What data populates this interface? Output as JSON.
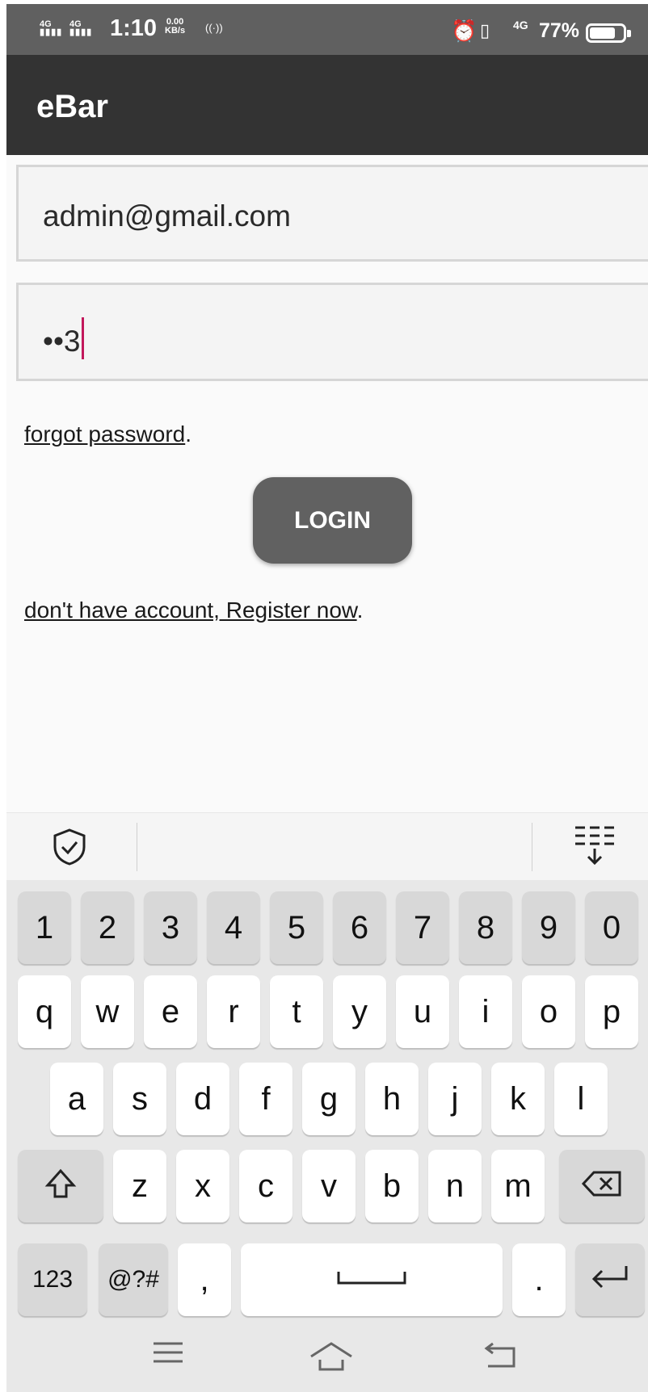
{
  "status_bar": {
    "sig1": "4G",
    "sig2": "4G",
    "time": "1:10",
    "speed_value": "0.00",
    "speed_unit": "KB/s",
    "net_type": "4G",
    "battery_percent": "77%",
    "battery_level": 0.77
  },
  "app_bar": {
    "title": "eBar"
  },
  "login_form": {
    "email_value": "admin@gmail.com",
    "password_value": "••3",
    "forgot_link": "forgot password",
    "forgot_suffix": ".",
    "login_label": "LOGIN",
    "register_link": "don't have account, Register now",
    "register_suffix": "."
  },
  "keyboard": {
    "row_numbers": [
      "1",
      "2",
      "3",
      "4",
      "5",
      "6",
      "7",
      "8",
      "9",
      "0"
    ],
    "row_top": [
      "q",
      "w",
      "e",
      "r",
      "t",
      "y",
      "u",
      "i",
      "o",
      "p"
    ],
    "row_home": [
      "a",
      "s",
      "d",
      "f",
      "g",
      "h",
      "j",
      "k",
      "l"
    ],
    "row_bottom": [
      "z",
      "x",
      "c",
      "v",
      "b",
      "n",
      "m"
    ],
    "mode_123": "123",
    "symbols": "@?#",
    "comma": ",",
    "period": "."
  },
  "icons": {
    "shield": "shield-check-icon",
    "collapse": "keyboard-hide-icon",
    "shift": "shift-icon",
    "backspace": "backspace-icon",
    "space": "space-bar-icon",
    "enter": "enter-icon",
    "menu": "menu-icon",
    "home": "home-icon",
    "back": "back-icon"
  }
}
